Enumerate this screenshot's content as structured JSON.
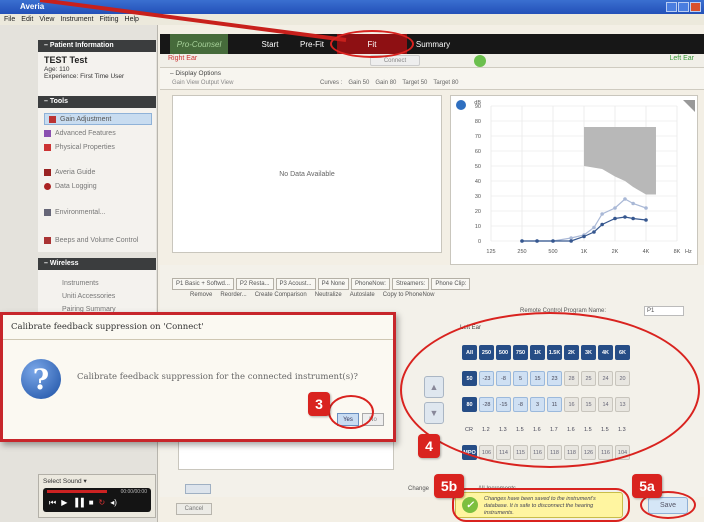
{
  "app": {
    "title": "Averia",
    "menu": [
      "File",
      "Edit",
      "View",
      "Instrument",
      "Fitting",
      "Help"
    ]
  },
  "tabs": {
    "procounsel": "Pro-Counsel",
    "start": "Start",
    "prefit": "Pre-Fit",
    "fit": "Fit",
    "summary": "Summary"
  },
  "patient": {
    "header": "Patient Information",
    "name": "TEST Test",
    "age": "Age: 110",
    "experience": "Experience: First Time User"
  },
  "tools": {
    "header": "Tools",
    "items": [
      "Gain Adjustment",
      "Advanced Features",
      "Physical Properties",
      "Averia Guide",
      "Data Logging",
      "Environmental...",
      "Beeps and Volume Control"
    ]
  },
  "wireless": {
    "header": "Wireless",
    "items": [
      "Instruments",
      "Uniti Accessories",
      "Pairing Summary"
    ]
  },
  "ear": {
    "right": "Right Ear",
    "left": "Left Ear",
    "connect": "Connect"
  },
  "display_options": {
    "header": "Display Options",
    "view": "Gain View  Output View",
    "curves_label": "Curves :",
    "curves": [
      "Gain 50",
      "Gain 80",
      "Target 50",
      "Target 80"
    ]
  },
  "nodata": "No Data Available",
  "chart_data": {
    "type": "line",
    "title": "",
    "xlabel": "Hz",
    "ylabel": "dB",
    "x": [
      125,
      250,
      500,
      1000,
      2000,
      4000,
      8000
    ],
    "x_tick_labels": [
      "125",
      "250",
      "500",
      "1K",
      "2K",
      "4K",
      "8K"
    ],
    "y_ticks": [
      0,
      10,
      20,
      30,
      40,
      50,
      60,
      70,
      80,
      90
    ],
    "ylim": [
      0,
      90
    ],
    "series": [
      {
        "x": [
          250,
          350,
          500,
          750,
          1000,
          1250,
          1500,
          2000,
          2500,
          3000,
          4000
        ],
        "values": [
          0,
          0,
          0,
          2,
          4,
          9,
          18,
          22,
          28,
          25,
          22
        ],
        "color": "#a9b8d6"
      },
      {
        "x": [
          250,
          350,
          500,
          750,
          1000,
          1250,
          1500,
          2000,
          2500,
          3000,
          4000
        ],
        "values": [
          0,
          0,
          0,
          0,
          3,
          6,
          11,
          15,
          16,
          15,
          14
        ],
        "color": "#36578f"
      }
    ],
    "threshold_band": {
      "x": [
        1000,
        1500,
        2000,
        2500,
        3000,
        4000,
        5000
      ],
      "top": [
        76,
        76,
        76,
        76,
        76,
        76,
        76
      ],
      "bottom": [
        50,
        48,
        43,
        40,
        36,
        31,
        31
      ],
      "color": "#b8b8b8"
    }
  },
  "program_tabs": [
    "P1 Basic + Softwd...",
    "P2 Resta...",
    "P3 Acoust...",
    "P4 None",
    "PhoneNow:",
    "Streamers:",
    "Phone Clip:"
  ],
  "toolbar": [
    "Remove",
    "Reorder...",
    "Create Comparison",
    "Neutralize",
    "Autoslate",
    "Copy to PhoneNow"
  ],
  "remote_label": "Remote Control Program Name:",
  "remote_value": "P1",
  "matrix": {
    "ear_label": "Left Ear",
    "headers": [
      "All",
      "250",
      "500",
      "750",
      "1K",
      "1.5K",
      "2K",
      "3K",
      "4K",
      "6K"
    ],
    "rows": [
      {
        "label": "50",
        "values": [
          "-23",
          "-8",
          "5",
          "15",
          "23",
          "28",
          "25",
          "24",
          "20"
        ]
      },
      {
        "label": "80",
        "values": [
          "-28",
          "-15",
          "-8",
          "3",
          "11",
          "16",
          "15",
          "14",
          "13"
        ]
      }
    ],
    "cr_label": "CR",
    "cr_values": [
      "1.2",
      "1.3",
      "1.5",
      "1.6",
      "1.7",
      "1.6",
      "1.5",
      "1.5",
      "1.3"
    ],
    "mpo_label": "MPO",
    "mpo_values": [
      "106",
      "114",
      "115",
      "116",
      "118",
      "118",
      "126",
      "116",
      "104"
    ]
  },
  "dialog": {
    "title": "Calibrate feedback suppression on 'Connect'",
    "message": "Calibrate feedback suppression for the connected instrument(s)?",
    "yes": "Yes",
    "no": "No"
  },
  "annotations": {
    "step3": "3",
    "step4": "4",
    "step5a": "5a",
    "step5b": "5b"
  },
  "sound": {
    "label": "Select Sound",
    "time": "00:00/00:00"
  },
  "status": {
    "message": "Changes have been saved to the instrument's database. It is safe to disconnect the hearing instruments."
  },
  "buttons": {
    "save": "Save",
    "cancel": "Cancel",
    "all_increments": "All Increments",
    "change": "Change"
  }
}
